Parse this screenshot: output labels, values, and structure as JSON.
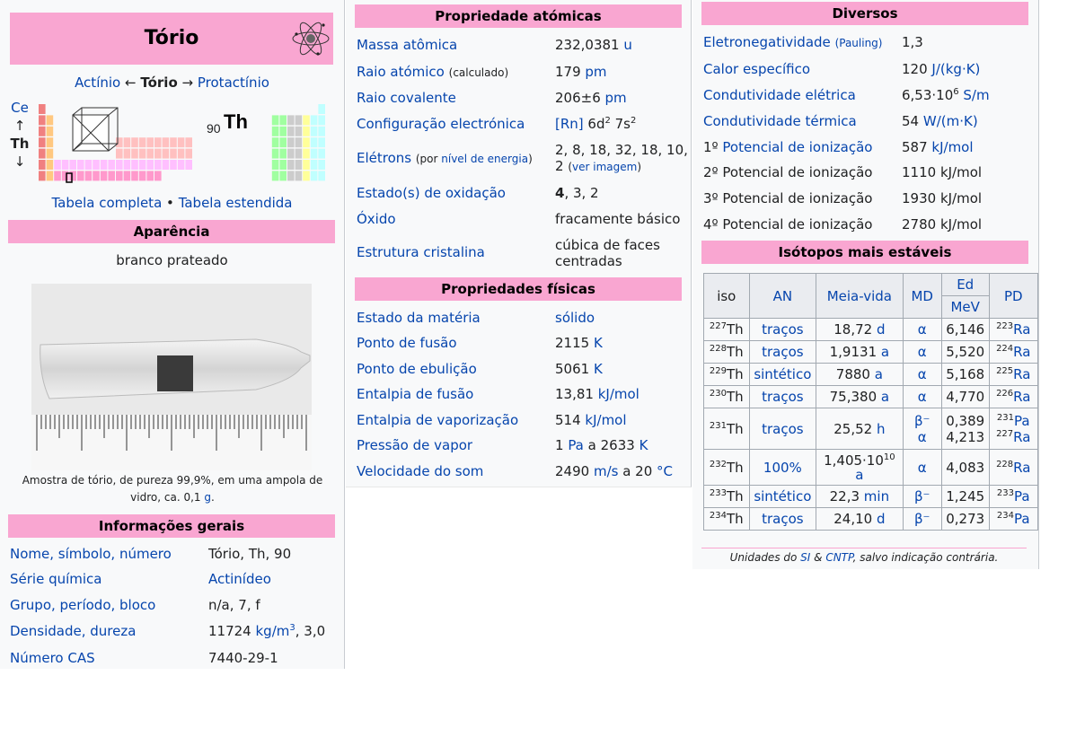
{
  "title": "Tório",
  "nav": {
    "prev": "Actínio",
    "arrow_prev": "←",
    "current": "Tório",
    "arrow_next": "→",
    "next": "Protactínio"
  },
  "ptable": {
    "above": "Ce",
    "up_arrow": "↑",
    "symbol": "Th",
    "down_arrow": "↓",
    "atomic_number": "90",
    "big_symbol": "Th"
  },
  "table_links": {
    "full": "Tabela completa",
    "sep": "•",
    "extended": "Tabela estendida"
  },
  "appearance": {
    "header": "Aparência",
    "text": "branco prateado",
    "caption_part1": "Amostra de tório, de pureza 99,9%, em uma ampola de vidro, ca. 0,1",
    "caption_link": "g",
    "caption_end": "."
  },
  "general": {
    "header": "Informações gerais",
    "rows": [
      {
        "label": "Nome, símbolo, número",
        "value": "Tório, Th, 90"
      },
      {
        "label": "Série química",
        "value": "Actinídeo"
      },
      {
        "label": "Grupo, período, bloco",
        "value": "n/a, 7, f"
      },
      {
        "label": "Densidade, dureza",
        "value_a": "11724 ",
        "value_unit": "kg/m",
        "value_sup": "3",
        "value_b": ", 3,0"
      },
      {
        "label": "Número CAS",
        "value": "7440-29-1"
      }
    ]
  },
  "atomic": {
    "header": "Propriedade atómicas",
    "mass_label": "Massa atômica",
    "mass_value": "232,0381 ",
    "mass_unit": "u",
    "radius_label": "Raio atómico",
    "radius_note": "(calculado)",
    "radius_value": "179 ",
    "radius_unit": "pm",
    "cov_label": "Raio covalente",
    "cov_value": "206±6 ",
    "cov_unit": "pm",
    "config_label": "Configuração electrónica",
    "config_rn": "[Rn]",
    "config_a": " 6d",
    "config_sup1": "2",
    "config_b": " 7s",
    "config_sup2": "2",
    "elec_label": "Elétrons",
    "elec_note_a": "(por ",
    "elec_note_link": "nível de energia",
    "elec_note_b": ")",
    "elec_value": "2, 8, 18, 32, 18, 10,",
    "elec_value2": "2",
    "elec_image_a": "(",
    "elec_image_link": "ver imagem",
    "elec_image_b": ")",
    "ox_label": "Estado(s) de oxidação",
    "ox_bold": "4",
    "ox_rest": ", 3, 2",
    "oxide_label": "Óxido",
    "oxide_value": "fracamente básico",
    "crystal_label": "Estrutura cristalina",
    "crystal_value1": "cúbica de faces",
    "crystal_value2": "centradas"
  },
  "physical": {
    "header": "Propriedades físicas",
    "state_label": "Estado da matéria",
    "state_value": "sólido",
    "melt_label": "Ponto de fusão",
    "melt_value": "2115 ",
    "melt_unit": "K",
    "boil_label": "Ponto de ebulição",
    "boil_value": "5061 ",
    "boil_unit": "K",
    "fus_label": "Entalpia de fusão",
    "fus_value": "13,81 ",
    "fus_unit": "kJ/mol",
    "vap_label": "Entalpia de vaporização",
    "vap_value": "514 ",
    "vap_unit": "kJ/mol",
    "press_label": "Pressão de vapor",
    "press_a": "1 ",
    "press_unit1": "Pa",
    "press_b": " a 2633 ",
    "press_unit2": "K",
    "sound_label": "Velocidade do som",
    "sound_a": "2490 ",
    "sound_unit1": "m/s",
    "sound_b": " a 20 ",
    "sound_unit2": "°C"
  },
  "misc": {
    "header": "Diversos",
    "en_label": "Eletronegatividade",
    "en_note": "(Pauling)",
    "en_value": "1,3",
    "heat_label": "Calor específico",
    "heat_value": "120 ",
    "heat_unit": "J/(kg·K)",
    "econd_label": "Condutividade elétrica",
    "econd_a": "6,53·10",
    "econd_sup": "6",
    "econd_unit": " S/m",
    "tcond_label": "Condutividade térmica",
    "tcond_value": "54 ",
    "tcond_unit": "W/(m·K)",
    "ion1_pre": "1º ",
    "ion1_label": "Potencial de ionização",
    "ion1_value": "587 ",
    "ion1_unit": "kJ/mol",
    "ion2_label": "2º Potencial de ionização",
    "ion2_value": "1110 kJ/mol",
    "ion3_label": "3º Potencial de ionização",
    "ion3_value": "1930 kJ/mol",
    "ion4_label": "4º Potencial de ionização",
    "ion4_value": "2780 kJ/mol"
  },
  "isotopes": {
    "header": "Isótopos mais estáveis",
    "col_iso": "iso",
    "col_an": "AN",
    "col_half": "Meia-vida",
    "col_md": "MD",
    "col_ed": "Ed",
    "col_mev": "MeV",
    "col_pd": "PD",
    "rows": [
      {
        "mass": "227",
        "sym": "Th",
        "an": "traços",
        "hl": "18,72 ",
        "hlu": "d",
        "md": "α",
        "ed": "6,146",
        "pdm": "223",
        "pds": "Ra"
      },
      {
        "mass": "228",
        "sym": "Th",
        "an": "traços",
        "hl": "1,9131 ",
        "hlu": "a",
        "md": "α",
        "ed": "5,520",
        "pdm": "224",
        "pds": "Ra"
      },
      {
        "mass": "229",
        "sym": "Th",
        "an": "sintético",
        "hl": "7880 ",
        "hlu": "a",
        "md": "α",
        "ed": "5,168",
        "pdm": "225",
        "pds": "Ra"
      },
      {
        "mass": "230",
        "sym": "Th",
        "an": "traços",
        "hl": "75,380 ",
        "hlu": "a",
        "md": "α",
        "ed": "4,770",
        "pdm": "226",
        "pds": "Ra"
      },
      {
        "mass": "231",
        "sym": "Th",
        "an": "traços",
        "hl": "25,52 ",
        "hlu": "h",
        "md": "β⁻",
        "md2": "α",
        "ed": "0,389",
        "ed2": "4,213",
        "pdm": "231",
        "pds": "Pa",
        "pdm2": "227",
        "pds2": "Ra"
      },
      {
        "mass": "232",
        "sym": "Th",
        "an": "100%",
        "hl": "1,405·10",
        "hlsup": "10",
        "hlu": "a",
        "md": "α",
        "ed": "4,083",
        "pdm": "228",
        "pds": "Ra"
      },
      {
        "mass": "233",
        "sym": "Th",
        "an": "sintético",
        "hl": "22,3 ",
        "hlu": "min",
        "md": "β⁻",
        "ed": "1,245",
        "pdm": "233",
        "pds": "Pa"
      },
      {
        "mass": "234",
        "sym": "Th",
        "an": "traços",
        "hl": "24,10 ",
        "hlu": "d",
        "md": "β⁻",
        "ed": "0,273",
        "pdm": "234",
        "pds": "Pa"
      }
    ],
    "foot_a": "Unidades do ",
    "foot_si": "SI",
    "foot_b": " & ",
    "foot_cntp": "CNTP",
    "foot_c": ", salvo indicação contrária."
  },
  "colors": {
    "header_pink": "#f9a6d1",
    "link": "#0645ad",
    "panel": "#f8f9fa"
  }
}
